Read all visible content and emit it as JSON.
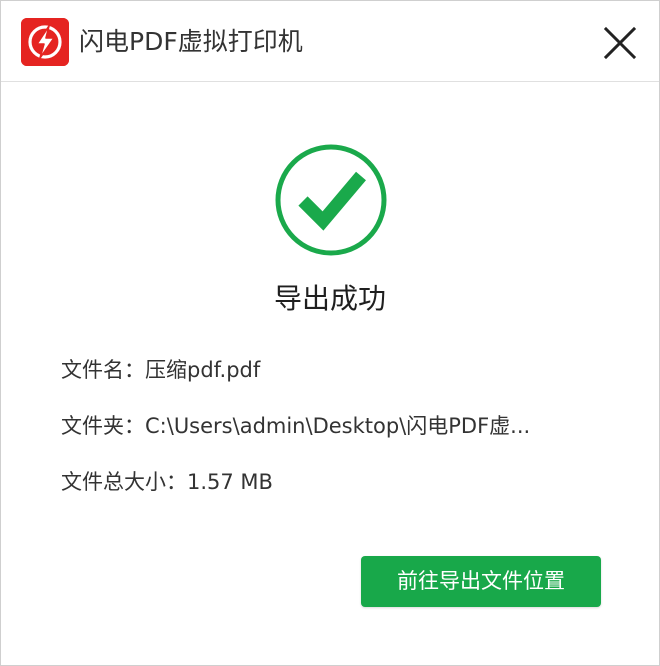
{
  "window": {
    "title": "闪电PDF虚拟打印机",
    "logo_icon": "lightning-bolt-logo",
    "close_icon": "close-icon"
  },
  "status": {
    "icon": "success-check-icon",
    "text": "导出成功"
  },
  "file_info": {
    "name_label": "文件名：",
    "name_value": "压缩pdf.pdf",
    "folder_label": "文件夹：",
    "folder_value": "C:\\Users\\admin\\Desktop\\闪电PDF虚...",
    "size_label": "文件总大小：",
    "size_value": "1.57 MB"
  },
  "actions": {
    "goto_label": "前往导出文件位置"
  },
  "colors": {
    "brand_red": "#e52421",
    "success_green": "#18a84a"
  }
}
